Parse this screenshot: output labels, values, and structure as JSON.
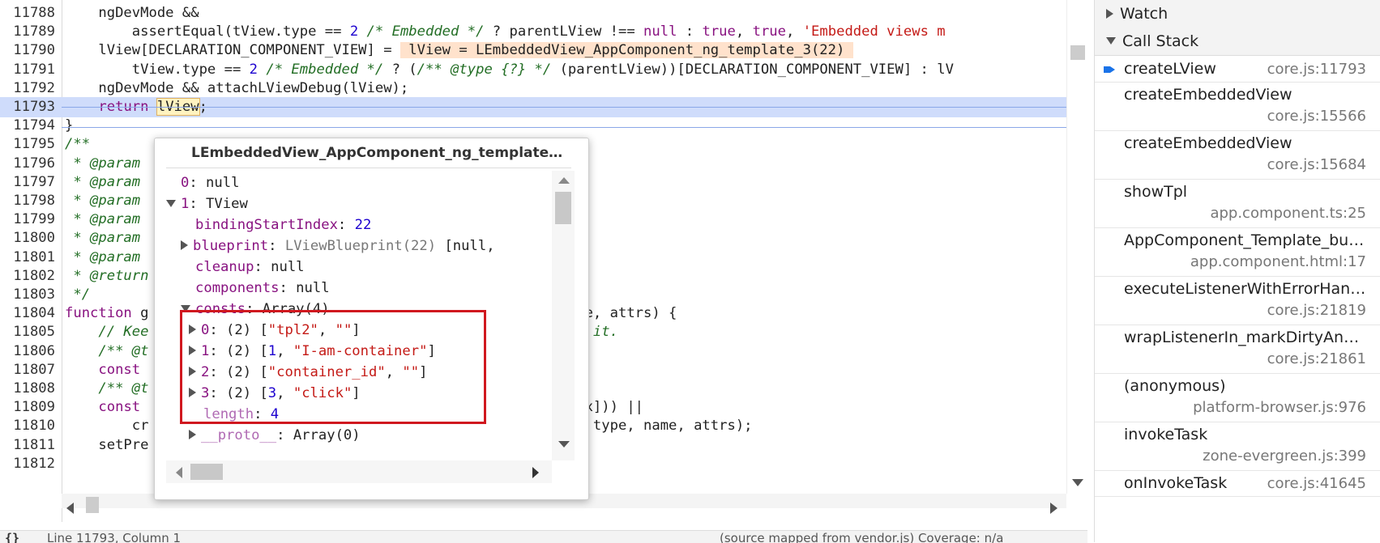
{
  "editor": {
    "lines": [
      {
        "n": "11788",
        "segs": [
          {
            "t": "    ngDevMode ",
            "c": ""
          },
          {
            "t": "&&",
            "c": ""
          }
        ]
      },
      {
        "n": "11789",
        "segs": [
          {
            "t": "        assertEqual(tView.type == ",
            "c": ""
          },
          {
            "t": "2",
            "c": "nm"
          },
          {
            "t": " ",
            "c": ""
          },
          {
            "t": "/* Embedded */",
            "c": "cm"
          },
          {
            "t": " ? parentLView !== ",
            "c": ""
          },
          {
            "t": "null",
            "c": "kw"
          },
          {
            "t": " : ",
            "c": ""
          },
          {
            "t": "true",
            "c": "kw"
          },
          {
            "t": ", ",
            "c": ""
          },
          {
            "t": "true",
            "c": "kw"
          },
          {
            "t": ", ",
            "c": ""
          },
          {
            "t": "'Embedded views m",
            "c": "st"
          }
        ]
      },
      {
        "n": "11790",
        "segs": [
          {
            "t": "    lView[DECLARATION_COMPONENT_VIEW] = ",
            "c": ""
          },
          {
            "t": " lView = LEmbeddedView_AppComponent_ng_template_3(22) ",
            "c": "ev"
          }
        ]
      },
      {
        "n": "11791",
        "segs": [
          {
            "t": "        tView.type == ",
            "c": ""
          },
          {
            "t": "2",
            "c": "nm"
          },
          {
            "t": " ",
            "c": ""
          },
          {
            "t": "/* Embedded */",
            "c": "cm"
          },
          {
            "t": " ? (",
            "c": ""
          },
          {
            "t": "/** @type {?} */",
            "c": "cm"
          },
          {
            "t": " (parentLView))[DECLARATION_COMPONENT_VIEW] : lV",
            "c": ""
          }
        ]
      },
      {
        "n": "11792",
        "segs": [
          {
            "t": "    ngDevMode && attachLViewDebug(lView);",
            "c": ""
          }
        ]
      },
      {
        "n": "11793",
        "segs": [
          {
            "t": "    ",
            "c": ""
          },
          {
            "t": "return",
            "c": "kw"
          },
          {
            "t": " ",
            "c": ""
          },
          {
            "t": "lView",
            "c": "tok"
          },
          {
            "t": ";",
            "c": ""
          }
        ],
        "hl": true
      },
      {
        "n": "11794",
        "segs": [
          {
            "t": "}",
            "c": ""
          }
        ]
      },
      {
        "n": "11795",
        "segs": [
          {
            "t": "/**",
            "c": "cm"
          }
        ]
      },
      {
        "n": "11796",
        "segs": [
          {
            "t": " * @param",
            "c": "cm"
          }
        ]
      },
      {
        "n": "11797",
        "segs": [
          {
            "t": " * @param",
            "c": "cm"
          }
        ]
      },
      {
        "n": "11798",
        "segs": [
          {
            "t": " * @param",
            "c": "cm"
          }
        ]
      },
      {
        "n": "11799",
        "segs": [
          {
            "t": " * @param",
            "c": "cm"
          }
        ]
      },
      {
        "n": "11800",
        "segs": [
          {
            "t": " * @param",
            "c": "cm"
          }
        ]
      },
      {
        "n": "11801",
        "segs": [
          {
            "t": " * @param",
            "c": "cm"
          }
        ]
      },
      {
        "n": "11802",
        "segs": [
          {
            "t": " * @return",
            "c": "cm"
          }
        ]
      },
      {
        "n": "11803",
        "segs": [
          {
            "t": " */",
            "c": "cm"
          }
        ]
      },
      {
        "n": "11804",
        "segs": [
          {
            "t": "function",
            "c": "kw"
          },
          {
            "t": " g                                               , name, attrs) {",
            "c": ""
          }
        ]
      },
      {
        "n": "11805",
        "segs": [
          {
            "t": "    // Kee                                                ",
            "c": "cm"
          },
          {
            "t": "line it.",
            "c": "cm"
          }
        ]
      },
      {
        "n": "11806",
        "segs": [
          {
            "t": "    /** @t",
            "c": "cm"
          }
        ]
      },
      {
        "n": "11807",
        "segs": [
          {
            "t": "    const",
            "c": "kw"
          }
        ]
      },
      {
        "n": "11808",
        "segs": [
          {
            "t": "    /** @t",
            "c": "cm"
          }
        ]
      },
      {
        "n": "11809",
        "segs": [
          {
            "t": "    ",
            "c": ""
          },
          {
            "t": "const",
            "c": "kw"
          },
          {
            "t": "                                                dIndex])) ||",
            "c": ""
          }
        ]
      },
      {
        "n": "11810",
        "segs": [
          {
            "t": "        cr                                                dex, type, name, attrs);",
            "c": ""
          }
        ]
      },
      {
        "n": "11811",
        "segs": [
          {
            "t": "    setPre",
            "c": ""
          }
        ]
      },
      {
        "n": "11812",
        "segs": [
          {
            "t": "",
            "c": ""
          }
        ]
      }
    ]
  },
  "popover": {
    "title": "LEmbeddedView_AppComponent_ng_template_…",
    "rows": [
      {
        "indent": 0,
        "tri": "",
        "parts": [
          {
            "t": "0",
            "c": "pk"
          },
          {
            "t": ": null",
            "c": ""
          }
        ]
      },
      {
        "indent": 0,
        "tri": "d",
        "parts": [
          {
            "t": "1",
            "c": "pk"
          },
          {
            "t": ": TView",
            "c": ""
          }
        ]
      },
      {
        "indent": 1,
        "tri": "",
        "parts": [
          {
            "t": "bindingStartIndex",
            "c": "pk"
          },
          {
            "t": ": ",
            "c": ""
          },
          {
            "t": "22",
            "c": "nm"
          }
        ]
      },
      {
        "indent": 1,
        "tri": "r",
        "parts": [
          {
            "t": "blueprint",
            "c": "pk"
          },
          {
            "t": ": ",
            "c": ""
          },
          {
            "t": "LViewBlueprint(22)",
            "c": "pgray"
          },
          {
            "t": " [null,",
            "c": ""
          }
        ]
      },
      {
        "indent": 1,
        "tri": "",
        "parts": [
          {
            "t": "cleanup",
            "c": "pk"
          },
          {
            "t": ": null",
            "c": ""
          }
        ]
      },
      {
        "indent": 1,
        "tri": "",
        "parts": [
          {
            "t": "components",
            "c": "pk"
          },
          {
            "t": ": null",
            "c": ""
          }
        ]
      },
      {
        "indent": 1,
        "tri": "d",
        "parts": [
          {
            "t": "consts",
            "c": "pk"
          },
          {
            "t": ": Array(4)",
            "c": ""
          }
        ]
      },
      {
        "indent": 2,
        "tri": "r",
        "parts": [
          {
            "t": "0",
            "c": "pk"
          },
          {
            "t": ": (2) [",
            "c": ""
          },
          {
            "t": "\"tpl2\"",
            "c": "st"
          },
          {
            "t": ", ",
            "c": ""
          },
          {
            "t": "\"\"",
            "c": "st"
          },
          {
            "t": "]",
            "c": ""
          }
        ]
      },
      {
        "indent": 2,
        "tri": "r",
        "parts": [
          {
            "t": "1",
            "c": "pk"
          },
          {
            "t": ": (2) [",
            "c": ""
          },
          {
            "t": "1",
            "c": "nm"
          },
          {
            "t": ", ",
            "c": ""
          },
          {
            "t": "\"I-am-container\"",
            "c": "st"
          },
          {
            "t": "]",
            "c": ""
          }
        ]
      },
      {
        "indent": 2,
        "tri": "r",
        "parts": [
          {
            "t": "2",
            "c": "pk"
          },
          {
            "t": ": (2) [",
            "c": ""
          },
          {
            "t": "\"container_id\"",
            "c": "st"
          },
          {
            "t": ", ",
            "c": ""
          },
          {
            "t": "\"\"",
            "c": "st"
          },
          {
            "t": "]",
            "c": ""
          }
        ]
      },
      {
        "indent": 2,
        "tri": "r",
        "parts": [
          {
            "t": "3",
            "c": "pk"
          },
          {
            "t": ": (2) [",
            "c": ""
          },
          {
            "t": "3",
            "c": "nm"
          },
          {
            "t": ", ",
            "c": ""
          },
          {
            "t": "\"click\"",
            "c": "st"
          },
          {
            "t": "]",
            "c": ""
          }
        ]
      },
      {
        "indent": 2,
        "tri": "",
        "parts": [
          {
            "t": "length",
            "c": "pkd"
          },
          {
            "t": ": ",
            "c": ""
          },
          {
            "t": "4",
            "c": "nm"
          }
        ]
      },
      {
        "indent": 2,
        "tri": "r",
        "parts": [
          {
            "t": "__proto__",
            "c": "pkd"
          },
          {
            "t": ": Array(0)",
            "c": ""
          }
        ]
      }
    ]
  },
  "statusbar": {
    "braces": "{}",
    "position": "Line 11793, Column 1",
    "source": "(source mapped from vendor.js)  Coverage: n/a"
  },
  "sidebar": {
    "watch_label": "Watch",
    "callstack_label": "Call Stack",
    "frames": [
      {
        "name": "createLView",
        "loc": "core.js:11793",
        "inline": true,
        "active": true
      },
      {
        "name": "createEmbeddedView",
        "loc": "core.js:15566",
        "inline": false
      },
      {
        "name": "createEmbeddedView",
        "loc": "core.js:15684",
        "inline": false
      },
      {
        "name": "showTpl",
        "loc": "app.component.ts:25",
        "inline": false
      },
      {
        "name": "AppComponent_Template_bu…",
        "loc": "app.component.html:17",
        "inline": false
      },
      {
        "name": "executeListenerWithErrorHan…",
        "loc": "core.js:21819",
        "inline": false
      },
      {
        "name": "wrapListenerIn_markDirtyAnd…",
        "loc": "core.js:21861",
        "inline": false
      },
      {
        "name": "(anonymous)",
        "loc": "platform-browser.js:976",
        "inline": false
      },
      {
        "name": "invokeTask",
        "loc": "zone-evergreen.js:399",
        "inline": false
      },
      {
        "name": "onInvokeTask",
        "loc": "core.js:41645",
        "inline": true
      }
    ]
  },
  "colors": {
    "highlight_line": "#cfdcfb",
    "keyword": "#881280",
    "comment": "#236e25",
    "string": "#c41a16",
    "number": "#1c00cf",
    "annotation_box": "#d0181f",
    "active_frame_arrow": "#1a73e8"
  },
  "icons": [
    "expand-triangle-icon",
    "collapse-triangle-icon",
    "current-frame-arrow-icon",
    "scroll-arrow-icon",
    "braces-icon"
  ]
}
